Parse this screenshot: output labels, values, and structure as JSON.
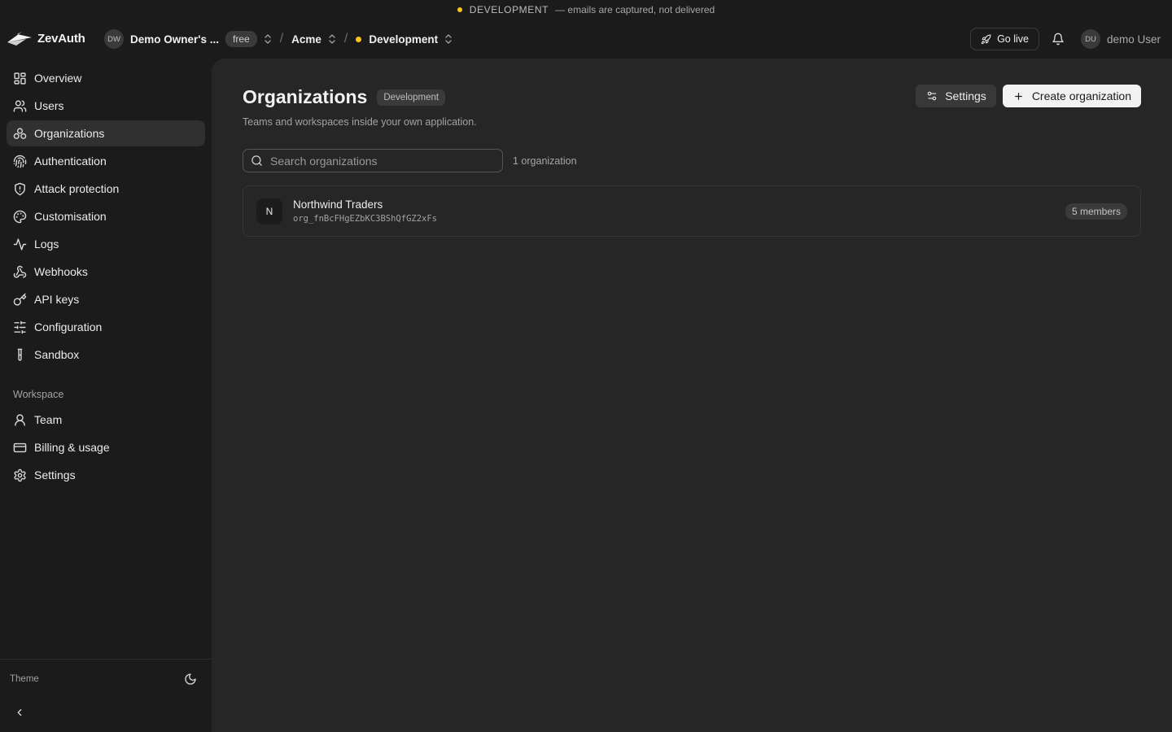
{
  "banner": {
    "env": "DEVELOPMENT",
    "message": "— emails are captured, not delivered",
    "dot_color": "#f5c518"
  },
  "topbar": {
    "logo_text": "ZevAuth",
    "tenant": {
      "initials": "DW",
      "name": "Demo Owner's ...",
      "plan": "free"
    },
    "separator": "/",
    "app": "Acme",
    "environment": "Development",
    "go_live": "Go live",
    "user": {
      "initials": "DU",
      "name": "demo User"
    }
  },
  "sidebar": {
    "items": [
      {
        "label": "Overview",
        "icon": "dashboard-icon"
      },
      {
        "label": "Users",
        "icon": "users-icon"
      },
      {
        "label": "Organizations",
        "icon": "organizations-icon",
        "active": true
      },
      {
        "label": "Authentication",
        "icon": "fingerprint-icon"
      },
      {
        "label": "Attack protection",
        "icon": "shield-icon"
      },
      {
        "label": "Customisation",
        "icon": "palette-icon"
      },
      {
        "label": "Logs",
        "icon": "activity-icon"
      },
      {
        "label": "Webhooks",
        "icon": "webhook-icon"
      },
      {
        "label": "API keys",
        "icon": "key-icon"
      },
      {
        "label": "Configuration",
        "icon": "sliders-icon"
      },
      {
        "label": "Sandbox",
        "icon": "test-tube-icon"
      }
    ],
    "workspace_label": "Workspace",
    "workspace_items": [
      {
        "label": "Team",
        "icon": "user-icon"
      },
      {
        "label": "Billing & usage",
        "icon": "credit-card-icon"
      },
      {
        "label": "Settings",
        "icon": "gear-icon"
      }
    ],
    "theme_label": "Theme"
  },
  "main": {
    "title": "Organizations",
    "env_badge": "Development",
    "subtitle": "Teams and workspaces inside your own application.",
    "settings_label": "Settings",
    "create_label": "Create organization",
    "search": {
      "placeholder": "Search organizations",
      "value": ""
    },
    "count_text": "1 organization",
    "organizations": [
      {
        "initial": "N",
        "name": "Northwind Traders",
        "id": "org_fnBcFHgEZbKC3BShQfGZ2xFs",
        "members": "5 members"
      }
    ]
  }
}
